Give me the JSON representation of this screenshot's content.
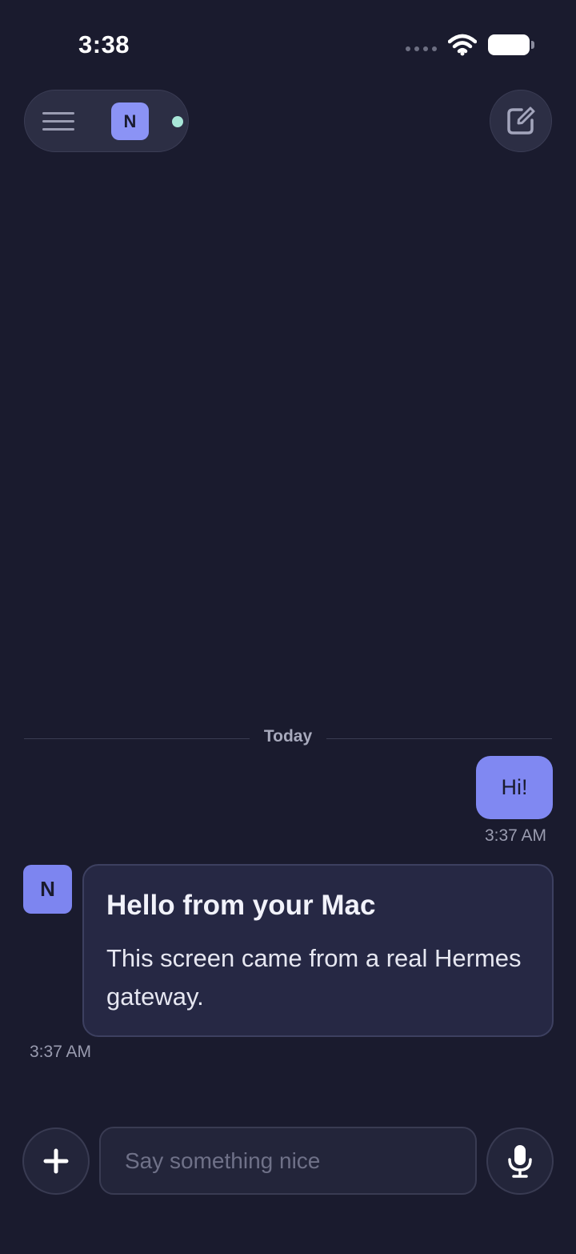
{
  "status_bar": {
    "time": "3:38"
  },
  "toolbar": {
    "agent_initial": "N"
  },
  "divider": {
    "label": "Today"
  },
  "messages": [
    {
      "from": "user",
      "text": "Hi!",
      "time": "3:37 AM"
    },
    {
      "from": "agent",
      "avatar_initial": "N",
      "title": "Hello from your Mac",
      "body": "This screen came from a real Hermes gateway.",
      "time": "3:37 AM"
    }
  ],
  "composer": {
    "placeholder": "Say something nice",
    "value": ""
  },
  "colors": {
    "background": "#1a1b2e",
    "accent": "#8088f2",
    "online": "#a8e6d8"
  }
}
